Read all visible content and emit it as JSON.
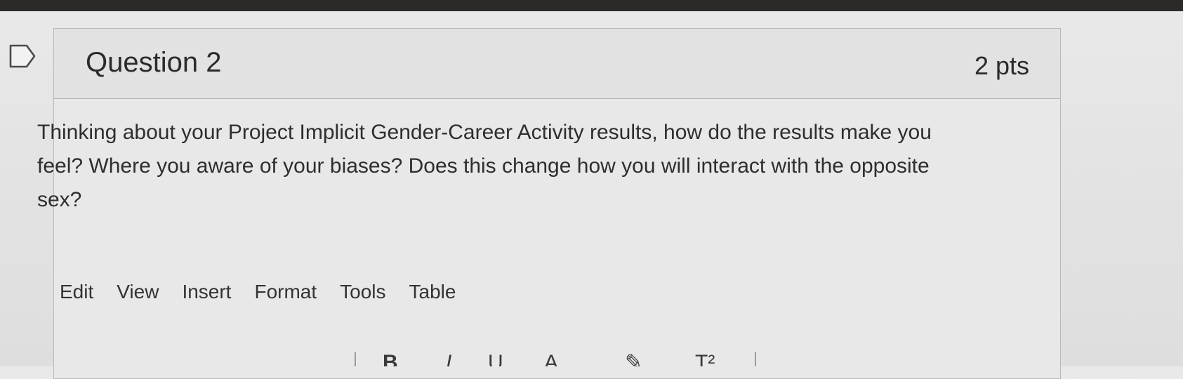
{
  "question": {
    "title": "Question 2",
    "points": "2 pts",
    "text": "Thinking about your Project Implicit Gender-Career Activity results, how do the results make you feel? Where you aware of your biases? Does this change how you will interact with the opposite sex?"
  },
  "editor": {
    "menu": [
      "Edit",
      "View",
      "Insert",
      "Format",
      "Tools",
      "Table"
    ]
  },
  "icons": {
    "bookmark": "bookmark-flag-icon"
  }
}
